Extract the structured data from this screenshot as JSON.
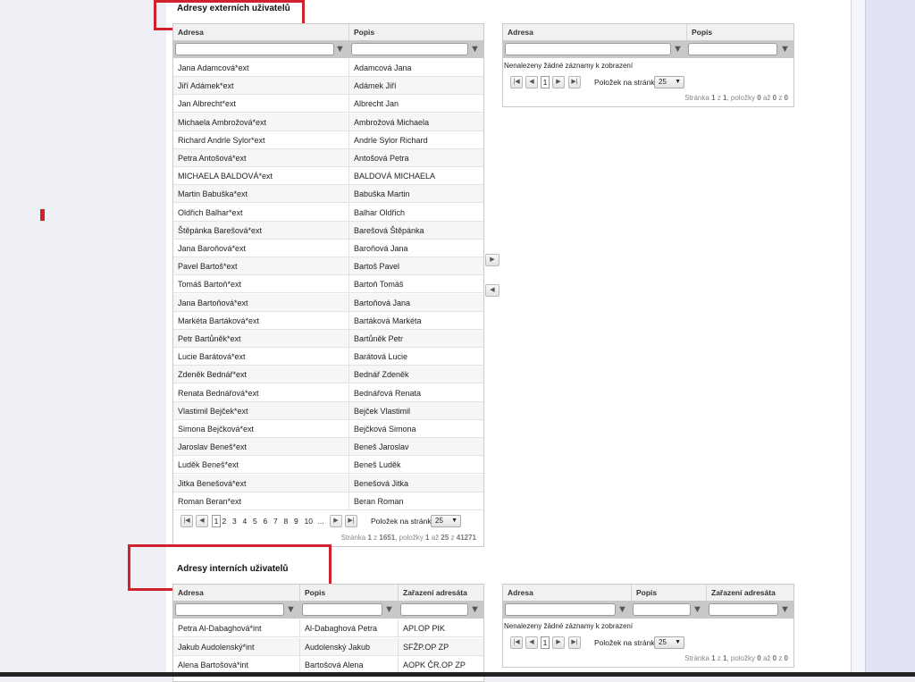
{
  "external": {
    "title": "Adresy externích uživatelů",
    "source": {
      "columns": [
        "Adresa",
        "Popis"
      ],
      "rows": [
        [
          "Jana Adamcová*ext",
          "Adamcová Jana"
        ],
        [
          "Jiří Adámek*ext",
          "Adámek Jiří"
        ],
        [
          "Jan Albrecht*ext",
          "Albrecht Jan"
        ],
        [
          "Michaela Ambrožová*ext",
          "Ambrožová Michaela"
        ],
        [
          "Richard Andrle Sylor*ext",
          "Andrle Sylor Richard"
        ],
        [
          "Petra Antošová*ext",
          "Antošová Petra"
        ],
        [
          "MICHAELA BALDOVÁ*ext",
          "BALDOVÁ MICHAELA"
        ],
        [
          "Martin Babuška*ext",
          "Babuška Martin"
        ],
        [
          "Oldřich Balhar*ext",
          "Balhar Oldřich"
        ],
        [
          "Štěpánka Barešová*ext",
          "Barešová Štěpánka"
        ],
        [
          "Jana Baroňová*ext",
          "Baroňová Jana"
        ],
        [
          "Pavel Bartoš*ext",
          "Bartoš Pavel"
        ],
        [
          "Tomáš Bartoň*ext",
          "Bartoň Tomáš"
        ],
        [
          "Jana Bartoňová*ext",
          "Bartoňová Jana"
        ],
        [
          "Markéta Bartáková*ext",
          "Bartáková Markéta"
        ],
        [
          "Petr Bartůněk*ext",
          "Bartůněk Petr"
        ],
        [
          "Lucie Barátová*ext",
          "Barátová Lucie"
        ],
        [
          "Zdeněk Bednář*ext",
          "Bednář Zdeněk"
        ],
        [
          "Renata Bednářová*ext",
          "Bednářová Renata"
        ],
        [
          "Vlastimil Bejček*ext",
          "Bejček Vlastimil"
        ],
        [
          "Simona Bejčková*ext",
          "Bejčková Simona"
        ],
        [
          "Jaroslav Beneš*ext",
          "Beneš Jaroslav"
        ],
        [
          "Luděk Beneš*ext",
          "Beneš Luděk"
        ],
        [
          "Jitka Benešová*ext",
          "Benešová Jitka"
        ],
        [
          "Roman Beran*ext",
          "Beran Roman"
        ]
      ],
      "pager": {
        "pages": [
          "1",
          "2",
          "3",
          "4",
          "5",
          "6",
          "7",
          "8",
          "9",
          "10",
          "..."
        ],
        "current": "1",
        "per_page_label": "Položek na stránku",
        "per_page": "25",
        "info": {
          "page_lbl": "Stránka",
          "page": "1",
          "of_lbl": "z",
          "pages_total": "1651",
          "items_lbl": ", položky",
          "from": "1",
          "to_lbl": "až",
          "to": "25",
          "z2": "z",
          "total": "41271"
        }
      }
    },
    "target": {
      "columns": [
        "Adresa",
        "Popis"
      ],
      "empty": "Nenalezeny žádné záznamy k zobrazení",
      "pager": {
        "current": "1",
        "per_page_label": "Položek na stránku",
        "per_page": "25",
        "info": {
          "page_lbl": "Stránka",
          "page": "1",
          "of_lbl": "z",
          "pages_total": "1",
          "items_lbl": ", položky",
          "from": "0",
          "to_lbl": "až",
          "to": "0",
          "z2": "z",
          "total": "0"
        }
      }
    },
    "move_right_icon": "arrow-right-icon",
    "move_left_icon": "arrow-left-icon"
  },
  "internal": {
    "title": "Adresy interních uživatelů",
    "source": {
      "columns": [
        "Adresa",
        "Popis",
        "Zařazení adresáta"
      ],
      "rows": [
        [
          "Petra Al-Dabaghová*int",
          "Al-Dabaghová Petra",
          "API.OP PIK"
        ],
        [
          "Jakub Audolenský*int",
          "Audolenský Jakub",
          "SFŽP.OP ZP"
        ],
        [
          "Alena Bartošová*int",
          "Bartošová Alena",
          "AOPK ČR.OP ZP"
        ]
      ]
    },
    "target": {
      "columns": [
        "Adresa",
        "Popis",
        "Zařazení adresáta"
      ],
      "empty": "Nenalezeny žádné záznamy k zobrazení",
      "pager": {
        "current": "1",
        "per_page_label": "Položek na stránku",
        "per_page": "25",
        "info": {
          "page_lbl": "Stránka",
          "page": "1",
          "of_lbl": "z",
          "pages_total": "1",
          "items_lbl": ", položky",
          "from": "0",
          "to_lbl": "až",
          "to": "0",
          "z2": "z",
          "total": "0"
        }
      }
    }
  },
  "colors": {
    "highlight": "#d0222c",
    "header_bg": "#f1f1f1",
    "filter_bg": "#c8c8c8"
  }
}
